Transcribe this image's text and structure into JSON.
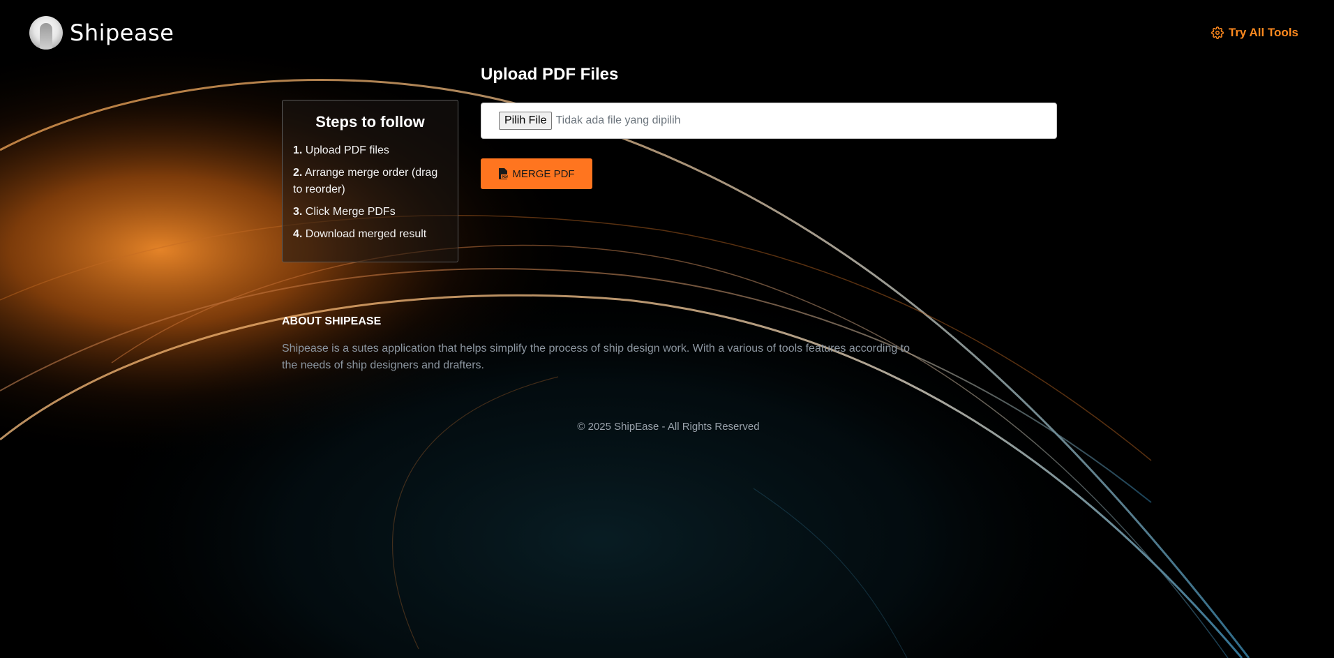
{
  "header": {
    "brand": "Shipease",
    "try_all_tools": "Try All Tools"
  },
  "steps": {
    "title": "Steps to follow",
    "items": [
      {
        "num": "1.",
        "text": " Upload PDF files"
      },
      {
        "num": "2.",
        "text": " Arrange merge order (drag to reorder)"
      },
      {
        "num": "3.",
        "text": " Click Merge PDFs"
      },
      {
        "num": "4.",
        "text": " Download merged result"
      }
    ]
  },
  "upload": {
    "title": "Upload PDF Files",
    "file_button": "Pilih File",
    "file_status": "Tidak ada file yang dipilih",
    "merge_button": "MERGE PDF"
  },
  "about": {
    "title": "ABOUT SHIPEASE",
    "text": "Shipease is a sutes application that helps simplify the process of ship design work. With a various of tools features according to the needs of ship designers and drafters."
  },
  "footer": {
    "text": "© 2025 ShipEase - All Rights Reserved"
  },
  "colors": {
    "accent": "#ff751f",
    "link": "#ff8a1f",
    "background": "#000000"
  },
  "icons": {
    "try_tools": "gear-icon",
    "merge": "pdf-file-icon",
    "logo": "avatar-logo"
  }
}
